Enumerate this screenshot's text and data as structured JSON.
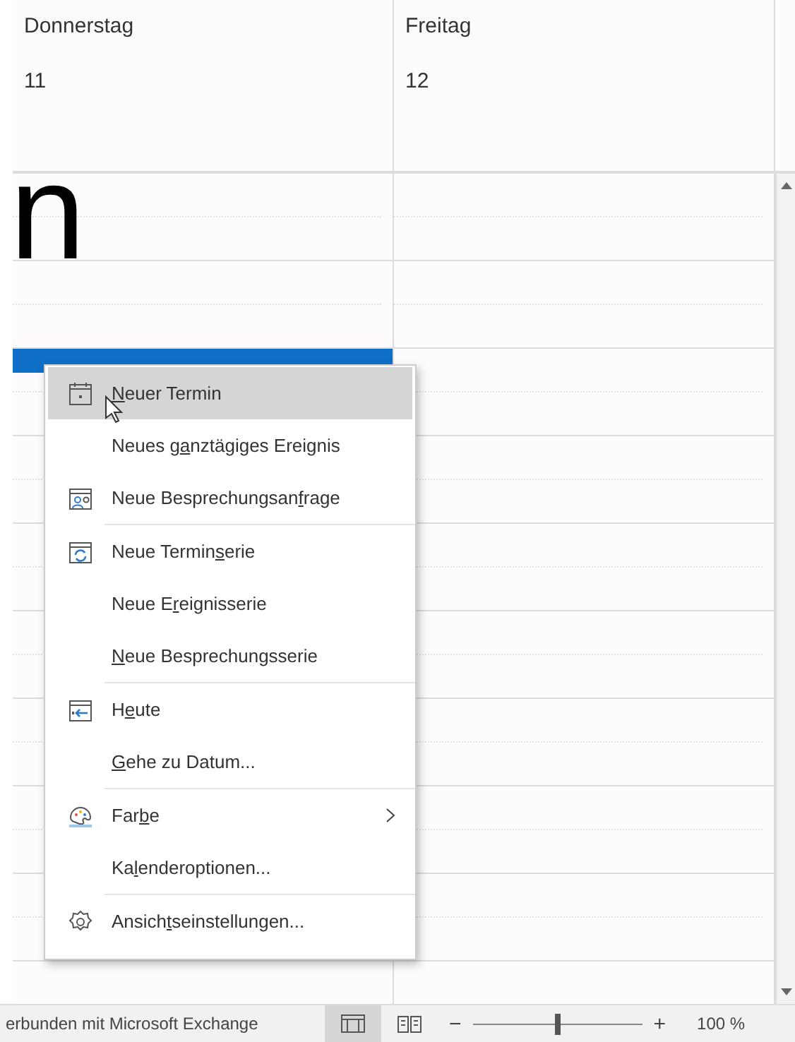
{
  "calendar": {
    "columns": [
      {
        "day": "Donnerstag",
        "date": "11"
      },
      {
        "day": "Freitag",
        "date": "12"
      }
    ],
    "overlay_letter": "n"
  },
  "context_menu": {
    "items": [
      {
        "key": "N",
        "after": "euer Termin",
        "kind": "calendar",
        "selected": true,
        "separator_after": false,
        "has_submenu": false
      },
      {
        "before": "Neues g",
        "key": "a",
        "after": "nztägiges Ereignis",
        "selected": false,
        "separator_after": false,
        "has_submenu": false
      },
      {
        "before": "Neue Besprechungsan",
        "key": "f",
        "after": "rage",
        "kind": "meeting",
        "selected": false,
        "separator_after": true,
        "has_submenu": false
      },
      {
        "before": "Neue Termin",
        "key": "s",
        "after": "erie",
        "kind": "recurring",
        "selected": false,
        "separator_after": false,
        "has_submenu": false
      },
      {
        "before": "Neue E",
        "key": "r",
        "after": "eignisserie",
        "selected": false,
        "separator_after": false,
        "has_submenu": false
      },
      {
        "key": "N",
        "after": "eue Besprechungsserie",
        "selected": false,
        "separator_after": true,
        "has_submenu": false
      },
      {
        "before": "H",
        "key": "e",
        "after": "ute",
        "kind": "today",
        "selected": false,
        "separator_after": false,
        "has_submenu": false
      },
      {
        "key": "G",
        "after": "ehe zu Datum...",
        "selected": false,
        "separator_after": true,
        "has_submenu": false
      },
      {
        "before": "Far",
        "key": "b",
        "after": "e",
        "kind": "palette",
        "selected": false,
        "separator_after": false,
        "has_submenu": true
      },
      {
        "before": "Ka",
        "key": "l",
        "after": "enderoptionen...",
        "selected": false,
        "separator_after": true,
        "has_submenu": false
      },
      {
        "before": "Ansich",
        "key": "t",
        "after": "seinstellungen...",
        "kind": "settings",
        "selected": false,
        "separator_after": false,
        "has_submenu": false
      }
    ]
  },
  "status_bar": {
    "connection": "erbunden mit Microsoft Exchange",
    "views": [
      {
        "kind": "normal",
        "selected": true
      },
      {
        "kind": "reading",
        "selected": false
      }
    ],
    "zoom": {
      "minus": "−",
      "plus": "+",
      "level": 0.5,
      "reading": "100 %"
    }
  }
}
